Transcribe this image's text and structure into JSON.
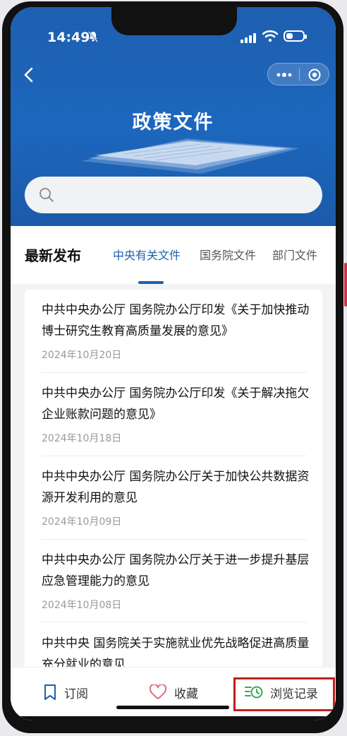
{
  "status_bar": {
    "time": "14:49"
  },
  "header": {
    "title": "政策文件"
  },
  "search": {
    "placeholder": ""
  },
  "tabs": {
    "section_title": "最新发布",
    "items": [
      {
        "label": "中央有关文件",
        "active": true
      },
      {
        "label": "国务院文件",
        "active": false
      },
      {
        "label": "部门文件",
        "active": false
      }
    ]
  },
  "documents": [
    {
      "title": "中共中央办公厅 国务院办公厅印发《关于加快推动博士研究生教育高质量发展的意见》",
      "date": "2024年10月20日"
    },
    {
      "title": "中共中央办公厅 国务院办公厅印发《关于解决拖欠企业账款问题的意见》",
      "date": "2024年10月18日"
    },
    {
      "title": "中共中央办公厅 国务院办公厅关于加快公共数据资源开发利用的意见",
      "date": "2024年10月09日"
    },
    {
      "title": "中共中央办公厅 国务院办公厅关于进一步提升基层应急管理能力的意见",
      "date": "2024年10月08日"
    },
    {
      "title": "中共中央 国务院关于实施就业优先战略促进高质量充分就业的意见",
      "date": ""
    }
  ],
  "bottom_nav": {
    "subscribe": "订阅",
    "favorite": "收藏",
    "history": "浏览记录"
  },
  "colors": {
    "brand_blue": "#1c5fb0",
    "history_green": "#3aa856",
    "highlight_red": "#c01f1f"
  }
}
